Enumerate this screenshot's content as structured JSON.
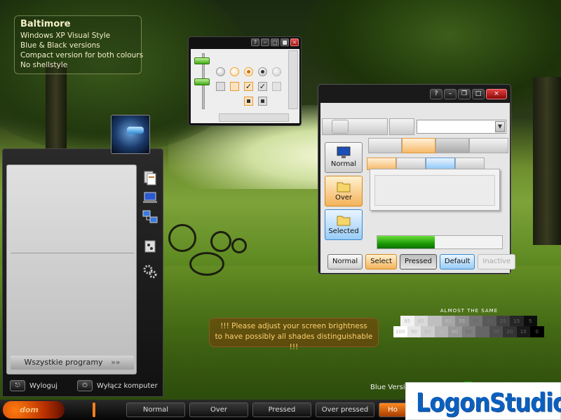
{
  "info": {
    "title": "Baltimore",
    "lines": [
      "Windows XP Visual Style",
      "Blue & Black versions",
      "Compact version for both colours",
      "No shellstyle"
    ]
  },
  "demo_window": {
    "caption_help": "?",
    "big_buttons": [
      {
        "label": "Normal",
        "state": "normal",
        "icon": "monitor-icon"
      },
      {
        "label": "Over",
        "state": "over",
        "icon": "folder-icon"
      },
      {
        "label": "Selected",
        "state": "selected",
        "icon": "folder-icon"
      }
    ],
    "progress_fraction": 0.46,
    "push_buttons": [
      "Normal",
      "Select",
      "Pressed",
      "Default",
      "Inactive"
    ]
  },
  "mini_window": {
    "caption_help": "?"
  },
  "start_menu": {
    "all_programs": "Wszystkie programy",
    "all_programs_arrows": "»»",
    "logoff": "Wyloguj",
    "shutdown": "Wyłącz komputer",
    "side_icons": [
      "documents-icon",
      "computer-icon",
      "network-icon",
      "control-panel-icon",
      "settings-icon"
    ]
  },
  "taskbar": {
    "start_label": "dom",
    "buttons": [
      "Normal",
      "Over",
      "Pressed",
      "Over pressed",
      "Ho"
    ]
  },
  "brightness": {
    "title": "ALMOST THE SAME",
    "row1": [
      "95",
      "85",
      "75",
      "65",
      "55",
      "45",
      "35",
      "25",
      "15",
      "5"
    ],
    "row2": [
      "100",
      "90",
      "80",
      "70",
      "60",
      "50",
      "40",
      "30",
      "20",
      "10",
      "0"
    ]
  },
  "notice": {
    "line1": "!!! Please adjust your screen brightness",
    "line2": "to have possibly all shades distinguishable !!!"
  },
  "footer": {
    "blue_version": "Blue Versi",
    "logo": "LogonStudio"
  },
  "colors": {
    "accent_orange": "#f08020",
    "progress_green": "#1a9a06",
    "logo_blue": "#0a5fbf"
  }
}
